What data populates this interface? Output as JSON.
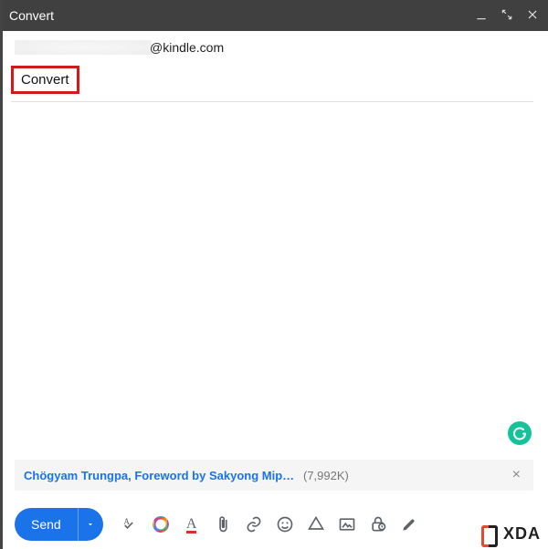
{
  "window": {
    "title": "Convert"
  },
  "to": {
    "redacted_suffix": "@kindle.com"
  },
  "subject": {
    "value": "Convert"
  },
  "attachment": {
    "filename": "Chögyam Trungpa, Foreword by Sakyong Mipha…",
    "size_label": "(7,992K)"
  },
  "toolbar": {
    "send_label": "Send"
  },
  "watermark": {
    "text": "XDA"
  }
}
